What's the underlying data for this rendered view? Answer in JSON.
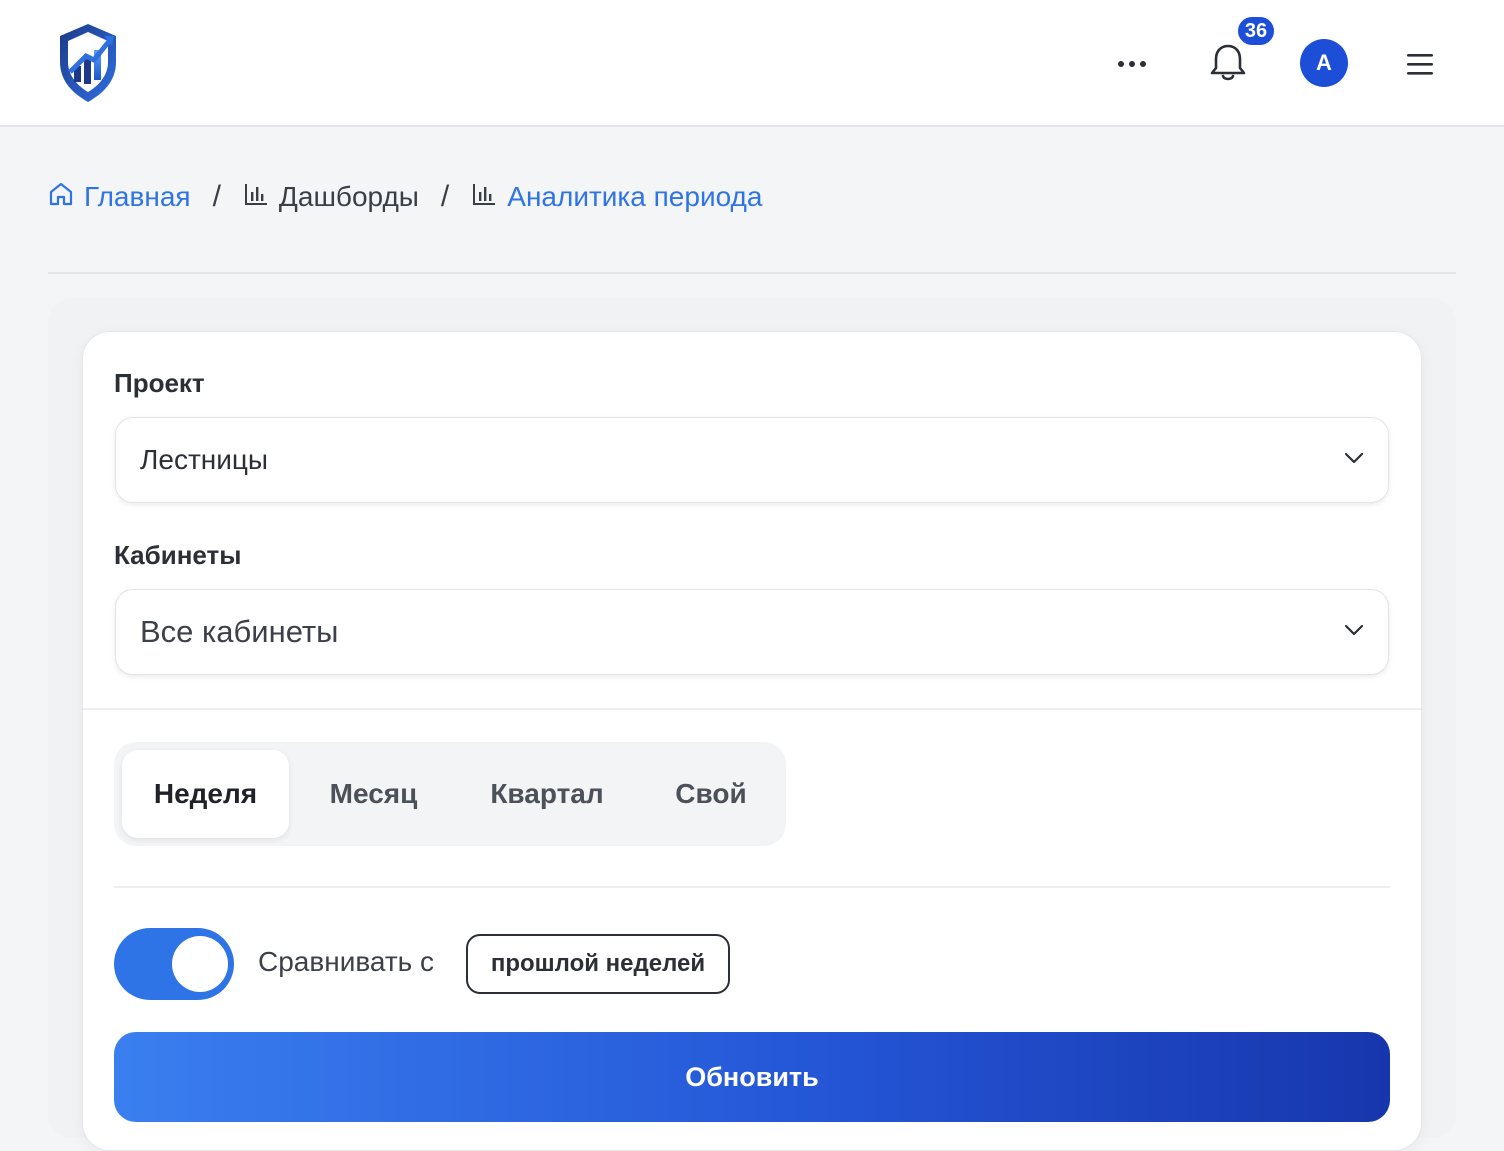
{
  "header": {
    "notifications_count": "36",
    "avatar_letter": "A"
  },
  "breadcrumb": {
    "items": [
      {
        "label": "Главная",
        "icon": "home-icon"
      },
      {
        "label": "Дашборды",
        "icon": "bar-chart-icon"
      },
      {
        "label": "Аналитика периода",
        "icon": "bar-chart-icon"
      }
    ],
    "separator": "/"
  },
  "filters": {
    "project_label": "Проект",
    "project_value": "Лестницы",
    "cabinets_label": "Кабинеты",
    "cabinets_value": "Все кабинеты"
  },
  "period": {
    "tabs": [
      "Неделя",
      "Месяц",
      "Квартал",
      "Свой"
    ],
    "active": "Неделя"
  },
  "compare": {
    "enabled": true,
    "label": "Сравнивать с",
    "option": "прошлой неделей"
  },
  "actions": {
    "refresh_label": "Обновить"
  },
  "colors": {
    "accent": "#2f74e6",
    "badge": "#1d4ed8",
    "button_gradient_start": "#3a7ff0",
    "button_gradient_end": "#1736ad"
  }
}
